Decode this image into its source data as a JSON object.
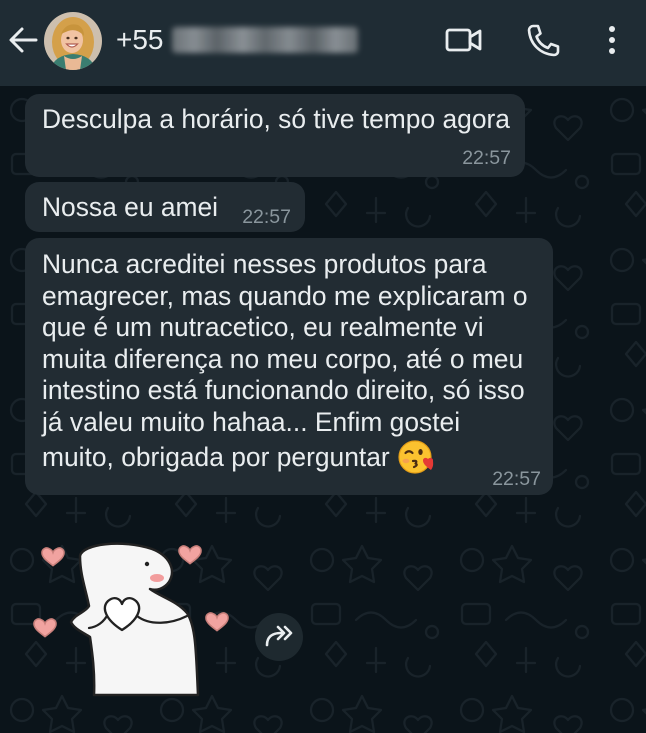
{
  "header": {
    "contact_name": "+55",
    "icons": {
      "back": "arrow-left-icon",
      "video_call": "video-camera-icon",
      "voice_call": "phone-icon",
      "menu": "more-vertical-icon"
    }
  },
  "messages": [
    {
      "text": "Desculpa a horário, só tive tempo agora",
      "time": "22:57"
    },
    {
      "text": "Nossa eu amei",
      "time": "22:57"
    },
    {
      "text": "Nunca acreditei nesses produtos para emagrecer, mas quando me explicaram o que é um nutracetico, eu realmente vi muita diferença no meu corpo, até o meu intestino está funcionando direito, só isso já valeu muito hahaa... Enfim gostei muito, obrigada por perguntar",
      "trailing_emoji": "face-blowing-a-kiss-icon",
      "time": "22:57"
    }
  ],
  "sticker": {
    "icon": "flork-heart-hands-sticker"
  },
  "forward_button": {
    "icon": "forward-icon"
  },
  "colors": {
    "header_bg": "#1f2c34",
    "chat_bg": "#0b141a",
    "wallpaper_doodle": "#19232a",
    "bubble_incoming": "#222c33",
    "text_primary": "#e9edef",
    "text_secondary": "#8a969d",
    "sticker_heart": "#f1a3a0"
  }
}
